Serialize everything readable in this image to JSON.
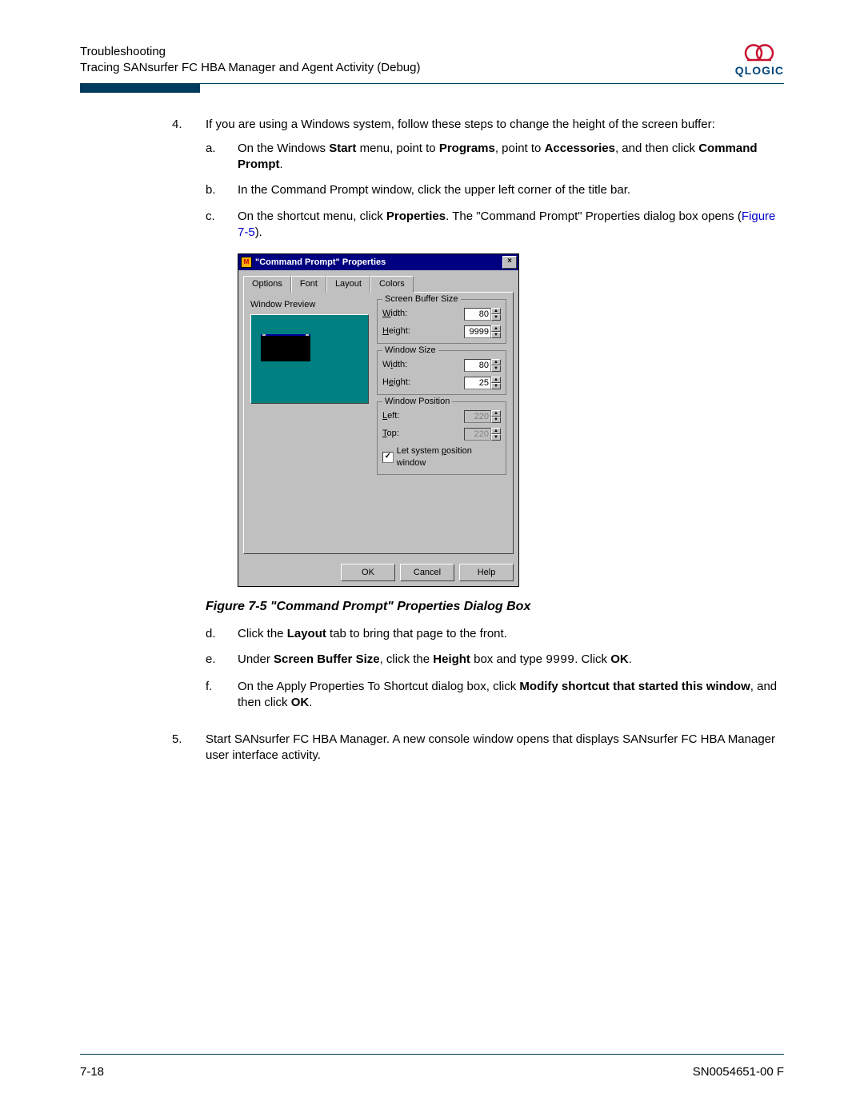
{
  "header": {
    "line1": "Troubleshooting",
    "line2": "Tracing SANsurfer FC HBA Manager and Agent Activity (Debug)",
    "logo_name": "QLOGIC"
  },
  "step4": {
    "num": "4.",
    "intro": "If you are using a Windows system, follow these steps to change the height of the screen buffer:",
    "a": {
      "letter": "a.",
      "p1": "On the Windows ",
      "b1": "Start",
      "p2": " menu, point to ",
      "b2": "Programs",
      "p3": ", point to ",
      "b3": "Accessories",
      "p4": ", and then click ",
      "b4": "Command Prompt",
      "p5": "."
    },
    "b": {
      "letter": "b.",
      "text": "In the Command Prompt window, click the upper left corner of the title bar."
    },
    "c": {
      "letter": "c.",
      "p1": "On the shortcut menu, click ",
      "b1": "Properties",
      "p2": ". The \"Command Prompt\" Properties dialog box opens (",
      "link": "Figure 7-5",
      "p3": ")."
    },
    "d": {
      "letter": "d.",
      "p1": "Click the ",
      "b1": "Layout",
      "p2": " tab to bring that page to the front."
    },
    "e": {
      "letter": "e.",
      "p1": "Under ",
      "b1": "Screen Buffer Size",
      "p2": ", click the ",
      "b2": "Height",
      "p3": " box and type ",
      "code": "9999",
      "p4": ". Click ",
      "b3": "OK",
      "p5": "."
    },
    "f": {
      "letter": "f.",
      "p1": "On the Apply Properties To Shortcut dialog box, click ",
      "b1": "Modify shortcut that started this window",
      "p2": ", and then click ",
      "b2": "OK",
      "p3": "."
    }
  },
  "step5": {
    "num": "5.",
    "text": "Start SANsurfer FC HBA Manager. A new console window opens that displays SANsurfer FC HBA Manager user interface activity."
  },
  "figure_caption": "Figure 7-5   \"Command Prompt\" Properties Dialog Box",
  "dialog": {
    "title": "\"Command Prompt\" Properties",
    "close_x": "×",
    "tabs": {
      "options": "Options",
      "font": "Font",
      "layout": "Layout",
      "colors": "Colors"
    },
    "preview_label": "Window Preview",
    "groups": {
      "buffer": {
        "title": "Screen Buffer Size",
        "width_label": "Width:",
        "width_value": "80",
        "height_label": "Height:",
        "height_value": "9999"
      },
      "window": {
        "title": "Window Size",
        "width_label": "Width:",
        "width_value": "80",
        "height_label": "Height:",
        "height_value": "25"
      },
      "position": {
        "title": "Window Position",
        "left_label": "Left:",
        "left_value": "220",
        "top_label": "Top:",
        "top_value": "220",
        "checkbox_label": "Let system position window",
        "checked": "✓"
      }
    },
    "buttons": {
      "ok": "OK",
      "cancel": "Cancel",
      "help": "Help"
    },
    "underlines": {
      "W": "W",
      "H": "H",
      "i": "i",
      "e": "e",
      "L": "L",
      "T": "T",
      "p": "p"
    }
  },
  "footer": {
    "page": "7-18",
    "doc_id": "SN0054651-00  F"
  }
}
